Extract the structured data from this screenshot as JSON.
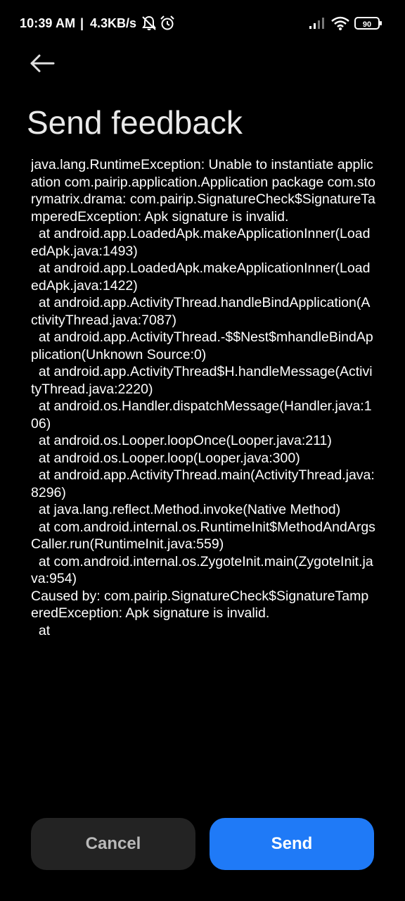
{
  "status_bar": {
    "time": "10:39 AM",
    "separator": "|",
    "network_speed": "4.3KB/s",
    "icons": [
      "bell-muted-icon",
      "alarm-icon",
      "signal-icon",
      "wifi-icon",
      "battery-icon"
    ],
    "battery_level": "90"
  },
  "header": {
    "back_icon": "arrow-left-icon",
    "title": "Send feedback"
  },
  "log": {
    "text": "java.lang.RuntimeException: Unable to instantiate application com.pairip.application.Application package com.storymatrix.drama: com.pairip.SignatureCheck$SignatureTamperedException: Apk signature is invalid.\n  at android.app.LoadedApk.makeApplicationInner(LoadedApk.java:1493)\n  at android.app.LoadedApk.makeApplicationInner(LoadedApk.java:1422)\n  at android.app.ActivityThread.handleBindApplication(ActivityThread.java:7087)\n  at android.app.ActivityThread.-$$Nest$mhandleBindApplication(Unknown Source:0)\n  at android.app.ActivityThread$H.handleMessage(ActivityThread.java:2220)\n  at android.os.Handler.dispatchMessage(Handler.java:106)\n  at android.os.Looper.loopOnce(Looper.java:211)\n  at android.os.Looper.loop(Looper.java:300)\n  at android.app.ActivityThread.main(ActivityThread.java:8296)\n  at java.lang.reflect.Method.invoke(Native Method)\n  at com.android.internal.os.RuntimeInit$MethodAndArgsCaller.run(RuntimeInit.java:559)\n  at com.android.internal.os.ZygoteInit.main(ZygoteInit.java:954)\nCaused by: com.pairip.SignatureCheck$SignatureTamperedException: Apk signature is invalid.\n  at"
  },
  "actions": {
    "cancel_label": "Cancel",
    "send_label": "Send"
  },
  "colors": {
    "background": "#000000",
    "send_button": "#1f7af7",
    "cancel_button": "#232323"
  }
}
